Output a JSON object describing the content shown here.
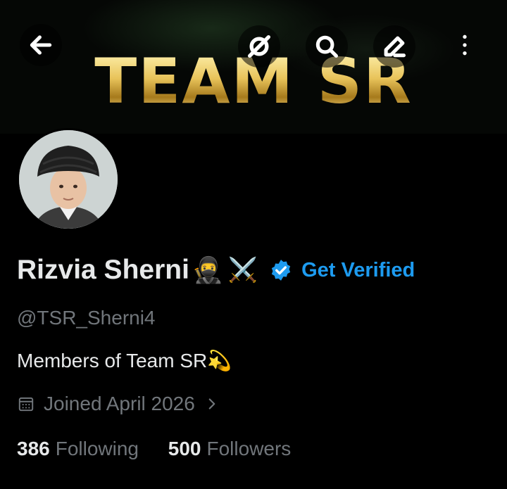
{
  "banner": {
    "title": "TEAM SR"
  },
  "toolbar": {
    "back_icon": "arrow-left-icon",
    "grok_icon": "grok-icon",
    "search_icon": "search-icon",
    "edit_icon": "pencil-icon",
    "more_icon": "more-vertical-icon"
  },
  "profile": {
    "display_name": "Rizvia Sherni",
    "name_emojis": [
      "🥷",
      "⚔️"
    ],
    "verified_badge_icon": "verified-badge-icon",
    "get_verified_label": "Get Verified",
    "handle": "@TSR_Sherni4",
    "bio": "Members of Team SR💫",
    "joined": "Joined April 2026",
    "following_count": "386",
    "following_label": "Following",
    "followers_count": "500",
    "followers_label": "Followers"
  },
  "colors": {
    "background": "#000000",
    "primary_text": "#e7e9ea",
    "secondary_text": "#71767b",
    "accent_blue": "#1d9bf0",
    "banner_gold": "#e8c35a"
  }
}
